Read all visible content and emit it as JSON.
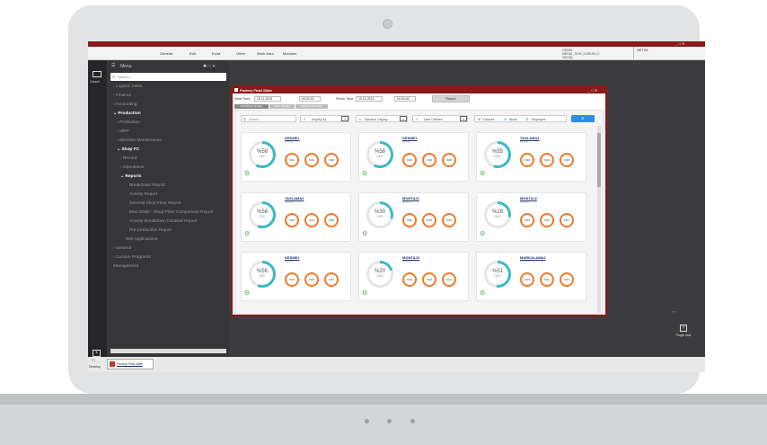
{
  "menubar": {
    "items": [
      "General",
      "Edit",
      "Extra",
      "Other",
      "Work Area",
      "Modules"
    ],
    "user_line1": "GENEL",
    "user_line2": "MERAL_SON_DURUM | 0",
    "user_line3": "MSSQL",
    "net": "NET05"
  },
  "leftbar": {
    "cancel_label": "Cancel",
    "desktop_add": "Desktop Add"
  },
  "sidebar": {
    "title": "Menu",
    "search_placeholder": "Search...",
    "items": [
      "Logistic Sales",
      "Finance",
      "Accounting",
      "Production",
      "Production",
      "MRP",
      "Machine Maintenance",
      "Shop FC",
      "Record",
      "Operations",
      "Reports",
      "Breakdown Report",
      "Activity Report",
      "General Shop Floor Report",
      "Man.Order - Shop Floor Comparison Report",
      "Activity-Breakdown Detailed Report",
      "Pre-production Report",
      "NOI Applications",
      "General",
      "Custom Programs",
      "Management"
    ]
  },
  "right_panel": {
    "plugin_label": "Plugin Add"
  },
  "taskbar": {
    "desktop": "Desktop",
    "tab": "Factory Final state"
  },
  "window": {
    "title": "Factory Final State",
    "start_label": "Start Time",
    "start_date": "15.11.2019",
    "start_time": "00:00:00",
    "finish_label": "Finish Time",
    "finish_date": "10.12.2019",
    "finish_time": "00:00:00",
    "report_button": "Report",
    "tabs": [
      "WorkFloor Display",
      "Lane Display",
      "Added Information"
    ],
    "search_placeholder": "Search...",
    "filter1": "Display All",
    "filter2": "Machine Display",
    "filter3": "User Defined",
    "legend": [
      "Failures",
      "Block",
      "Employee"
    ]
  },
  "cards": [
    {
      "title": "KESME1",
      "code": "8STI01",
      "oee": "%58",
      "oee_label": "OEE",
      "a": "%94",
      "b": "%60",
      "c": "%98"
    },
    {
      "title": "KESME1",
      "code": "8STI01",
      "oee": "%58",
      "oee_label": "OEE",
      "a": "%94",
      "b": "%60",
      "c": "%98"
    },
    {
      "title": "TASLAMA1",
      "code": "8STI01",
      "oee": "%55",
      "oee_label": "OEE",
      "a": "%90",
      "b": "%63",
      "c": "%98"
    },
    {
      "title": "TASLAMA2",
      "code": "8STI05",
      "oee": "%56",
      "oee_label": "OEE",
      "a": "%91",
      "b": "%63",
      "c": "%89"
    },
    {
      "title": "MONTAJ1",
      "code": "8STI04",
      "oee": "%30",
      "oee_label": "OEE",
      "a": "%86",
      "b": "%36",
      "c": "%98"
    },
    {
      "title": "MONTAJ2",
      "code": "8STI06",
      "oee": "%28",
      "oee_label": "OEE",
      "a": "%90",
      "b": "%32",
      "c": "%97"
    },
    {
      "title": "KESME2",
      "code": "8STI01",
      "oee": "%56",
      "oee_label": "OEE",
      "a": "%93",
      "b": "%60",
      "c": "%97"
    },
    {
      "title": "MONTAJ3",
      "code": "8STI08",
      "oee": "%20",
      "oee_label": "OEE",
      "a": "%99",
      "b": "%23",
      "c": "%93"
    },
    {
      "title": "MARKALAMA2",
      "code": "8STI05",
      "oee": "%51",
      "oee_label": "OEE",
      "a": "%99",
      "b": "%61",
      "c": "%97"
    }
  ],
  "colors": {
    "accent": "#8a1a1a",
    "ring": "#3bb8c5",
    "small_ring": "#f07a2a",
    "report_btn": "#2f8de4"
  }
}
